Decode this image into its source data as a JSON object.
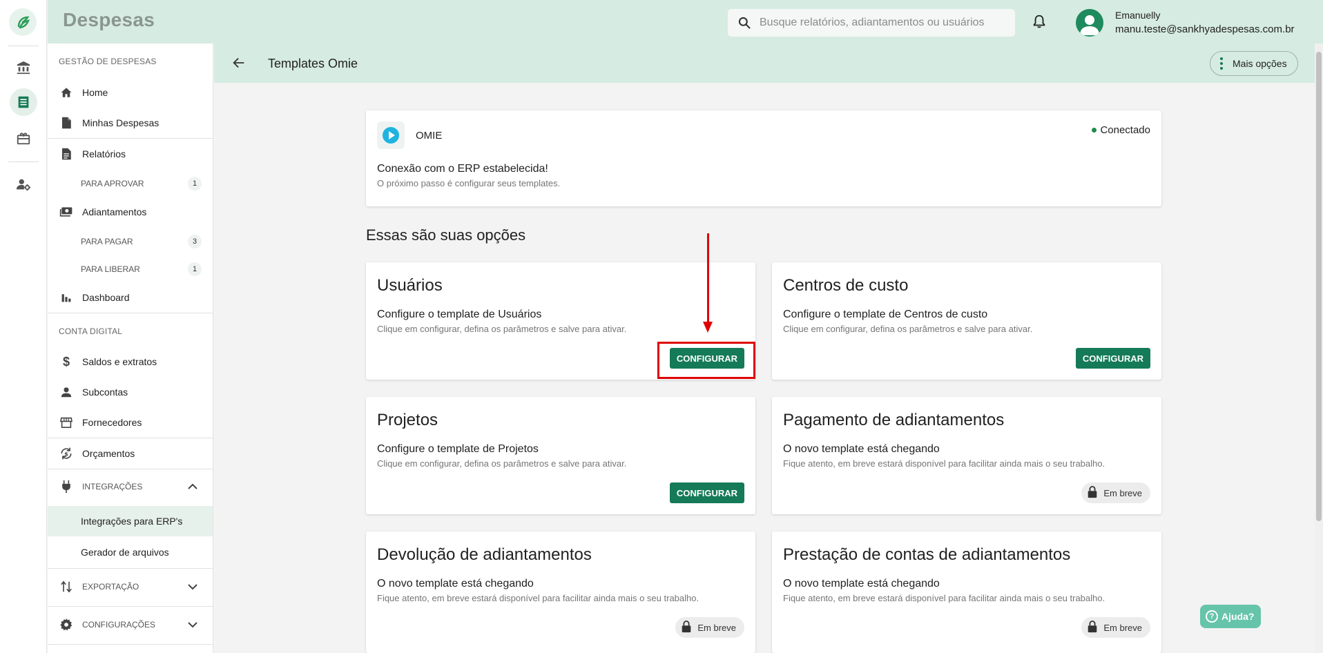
{
  "app": {
    "title": "Despesas"
  },
  "search": {
    "placeholder": "Busque relatórios, adiantamentos ou usuários"
  },
  "user": {
    "name": "Emanuelly",
    "email": "manu.teste@sankhyadespesas.com.br"
  },
  "sidebar": {
    "section_gestao": "GESTÃO DE DESPESAS",
    "home": "Home",
    "minhas_despesas": "Minhas Despesas",
    "relatorios": "Relatórios",
    "para_aprovar": {
      "label": "PARA APROVAR",
      "count": "1"
    },
    "adiantamentos": "Adiantamentos",
    "para_pagar": {
      "label": "PARA PAGAR",
      "count": "3"
    },
    "para_liberar": {
      "label": "PARA LIBERAR",
      "count": "1"
    },
    "dashboard": "Dashboard",
    "section_conta": "CONTA DIGITAL",
    "saldos": "Saldos e extratos",
    "subcontas": "Subcontas",
    "fornecedores": "Fornecedores",
    "orcamentos": "Orçamentos",
    "integracoes": "INTEGRAÇÕES",
    "integracoes_erp": "Integrações para ERP's",
    "gerador": "Gerador de arquivos",
    "exportacao": "EXPORTAÇÃO",
    "configuracoes": "CONFIGURAÇÕES"
  },
  "page": {
    "title": "Templates Omie",
    "more_label": "Mais opções"
  },
  "erp": {
    "name": "OMIE",
    "status": "Conectado",
    "conn_title": "Conexão com o ERP estabelecida!",
    "conn_sub": "O próximo passo é configurar seus templates."
  },
  "options_title": "Essas são suas opções",
  "cards": [
    {
      "title": "Usuários",
      "subtitle": "Configure o template de Usuários",
      "desc": "Clique em configurar, defina os parâmetros e salve para ativar.",
      "action": "CONFIGURAR"
    },
    {
      "title": "Centros de custo",
      "subtitle": "Configure o template de Centros de custo",
      "desc": "Clique em configurar, defina os parâmetros e salve para ativar.",
      "action": "CONFIGURAR"
    },
    {
      "title": "Projetos",
      "subtitle": "Configure o template de Projetos",
      "desc": "Clique em configurar, defina os parâmetros e salve para ativar.",
      "action": "CONFIGURAR"
    },
    {
      "title": "Pagamento de adiantamentos",
      "subtitle": "O novo template está chegando",
      "desc": "Fique atento, em breve estará disponível para facilitar ainda mais o seu trabalho.",
      "action": "Em breve"
    },
    {
      "title": "Devolução de adiantamentos",
      "subtitle": "O novo template está chegando",
      "desc": "Fique atento, em breve estará disponível para facilitar ainda mais o seu trabalho.",
      "action": "Em breve"
    },
    {
      "title": "Prestação de contas de adiantamentos",
      "subtitle": "O novo template está chegando",
      "desc": "Fique atento, em breve estará disponível para facilitar ainda mais o seu trabalho.",
      "action": "Em breve"
    }
  ],
  "help": {
    "label": "Ajuda?",
    "icon_text": "?"
  },
  "colors": {
    "primary": "#157a58",
    "header_bg": "#d6ebe2",
    "annotation": "#e00000"
  }
}
